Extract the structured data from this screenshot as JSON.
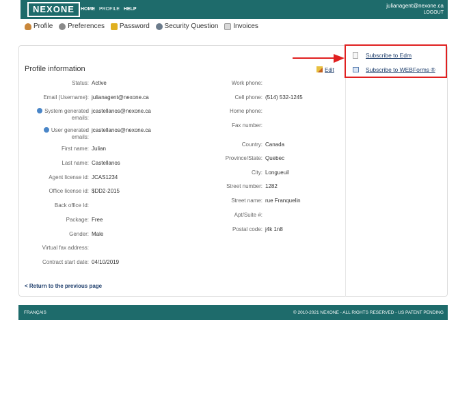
{
  "header": {
    "logo": "NEXONE",
    "nav": [
      "HOME",
      "PROFILE",
      "HELP"
    ],
    "user_email": "julianagent@nexone.ca",
    "logout": "LOGOUT"
  },
  "subnav": {
    "profile": "Profile",
    "preferences": "Preferences",
    "password": "Password",
    "security_question": "Security Question",
    "invoices": "Invoices"
  },
  "profile": {
    "title": "Profile information",
    "edit": "Edit",
    "left": [
      {
        "label": "Status:",
        "value": "Active"
      },
      {
        "label": "Email (Username):",
        "value": "julianagent@nexone.ca"
      },
      {
        "label": "System generated emails:",
        "value": "jcastellanos@nexone.ca"
      },
      {
        "label": "User generated emails:",
        "value": "jcastellanos@nexone.ca"
      },
      {
        "label": "First name:",
        "value": "Julian"
      },
      {
        "label": "Last name:",
        "value": "Castellanos"
      },
      {
        "label": "Agent license id:",
        "value": "JCAS1234"
      },
      {
        "label": "Office license id:",
        "value": "$DD2-2015"
      },
      {
        "label": "Back office Id:",
        "value": ""
      },
      {
        "label": "Package:",
        "value": "Free"
      },
      {
        "label": "Gender:",
        "value": "Male"
      },
      {
        "label": "Virtual fax address:",
        "value": ""
      },
      {
        "label": "Contract start date:",
        "value": "04/10/2019"
      }
    ],
    "right": [
      {
        "label": "Work phone:",
        "value": ""
      },
      {
        "label": "Cell phone:",
        "value": "(514) 532-1245"
      },
      {
        "label": "Home phone:",
        "value": ""
      },
      {
        "label": "Fax number:",
        "value": ""
      },
      {
        "label": "Country:",
        "value": "Canada"
      },
      {
        "label": "Province/State:",
        "value": "Quebec"
      },
      {
        "label": "City:",
        "value": "Longueuil"
      },
      {
        "label": "Street number:",
        "value": "1282"
      },
      {
        "label": "Street name:",
        "value": "rue Franquelin"
      },
      {
        "label": "Apt/Suite #:",
        "value": ""
      },
      {
        "label": "Postal code:",
        "value": "j4k 1n8"
      }
    ],
    "back_link": "< Return to the previous page"
  },
  "sidebar": {
    "subscribe_edm": "Subscribe to Edm",
    "subscribe_webforms": "Subscribe to WEBForms ®"
  },
  "footer": {
    "language": "FRANÇAIS",
    "copyright": "© 2010-2021 NEXONE - ALL RIGHTS RESERVED - US PATENT PENDING"
  },
  "colors": {
    "brand": "#1e6b6b",
    "highlight": "#e02020",
    "link": "#1d3d6b"
  }
}
